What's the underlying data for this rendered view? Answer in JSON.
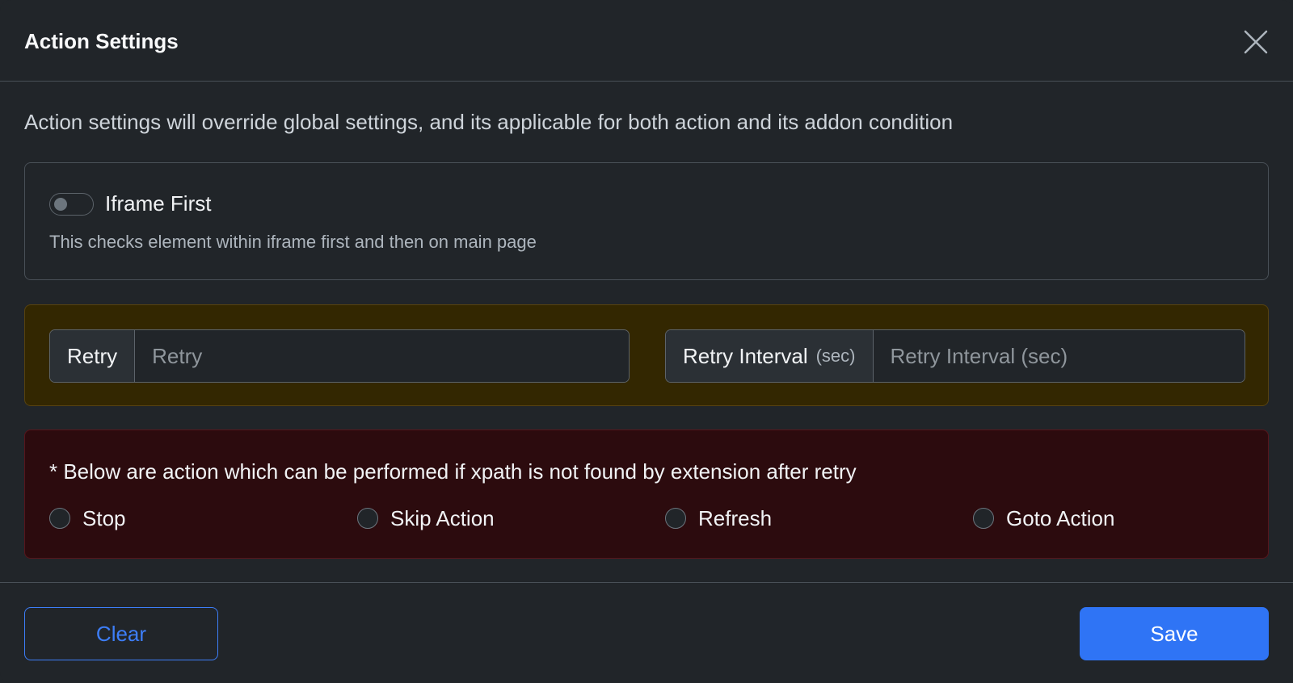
{
  "modal": {
    "title": "Action Settings",
    "description": "Action settings will override global settings, and its applicable for both action and its addon condition"
  },
  "iframe_first": {
    "label": "Iframe First",
    "help": "This checks element within iframe first and then on main page",
    "enabled": false
  },
  "retry": {
    "label": "Retry",
    "placeholder": "Retry",
    "value": ""
  },
  "retry_interval": {
    "label": "Retry Interval",
    "unit": "(sec)",
    "placeholder": "Retry Interval (sec)",
    "value": ""
  },
  "on_fail": {
    "note": "* Below are action which can be performed if xpath is not found by extension after retry",
    "options": [
      {
        "label": "Stop"
      },
      {
        "label": "Skip Action"
      },
      {
        "label": "Refresh"
      },
      {
        "label": "Goto Action"
      }
    ]
  },
  "footer": {
    "clear_label": "Clear",
    "save_label": "Save"
  },
  "icons": {
    "close": "close-icon"
  },
  "colors": {
    "primary": "#2f74f5",
    "warning_bg": "#332701",
    "danger_bg": "#2c0b0e"
  }
}
